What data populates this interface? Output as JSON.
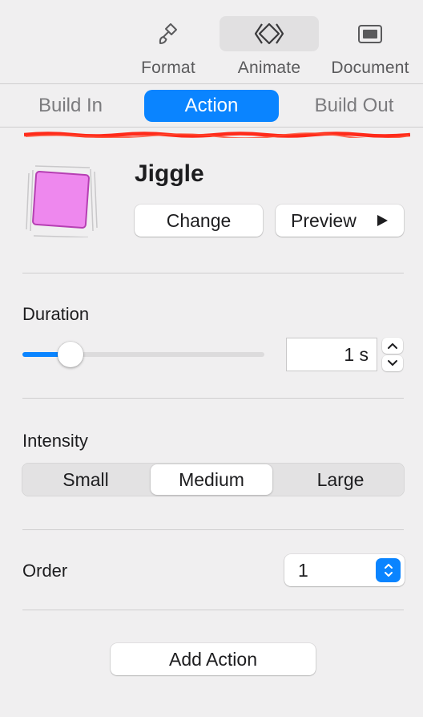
{
  "toolbar": {
    "items": [
      {
        "label": "Format",
        "icon": "paintbrush-icon"
      },
      {
        "label": "Animate",
        "icon": "diamond-animate-icon",
        "active": true
      },
      {
        "label": "Document",
        "icon": "document-icon"
      }
    ]
  },
  "tabs": {
    "items": [
      {
        "label": "Build In"
      },
      {
        "label": "Action",
        "active": true
      },
      {
        "label": "Build Out"
      }
    ]
  },
  "effect": {
    "name": "Jiggle",
    "change_label": "Change",
    "preview_label": "Preview",
    "preview_icon": "play-icon"
  },
  "duration": {
    "label": "Duration",
    "value": "1 s",
    "slider_fraction": 0.2
  },
  "intensity": {
    "label": "Intensity",
    "options": [
      "Small",
      "Medium",
      "Large"
    ],
    "selected": "Medium"
  },
  "order": {
    "label": "Order",
    "value": "1"
  },
  "add_action_label": "Add Action",
  "colors": {
    "accent": "#0a84ff",
    "annotation_underline": "#ff2a1a",
    "thumbnail_fill": "#ee88ee"
  }
}
